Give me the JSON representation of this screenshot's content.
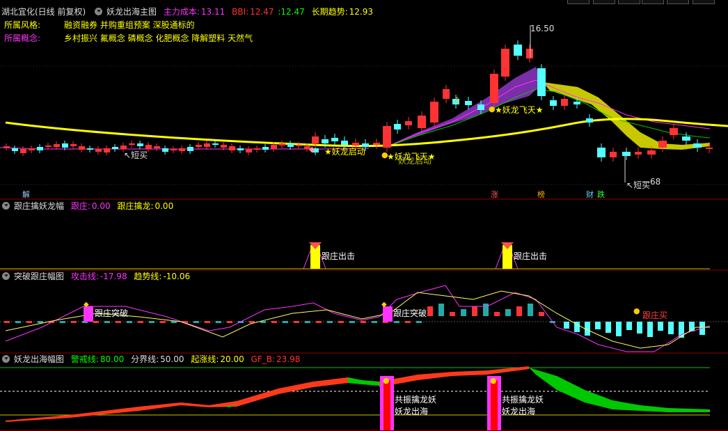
{
  "stock": {
    "title": "湖北宜化(日线 前复权)",
    "indicator": "妖龙出海主图",
    "main_cost_label": "主力成本:",
    "main_cost": "13.11",
    "bbi_label": "BBI:",
    "bbi": "12.47",
    "bbi2": ":12.47",
    "trend_label": "长期趋势:",
    "trend": "12.93"
  },
  "style": {
    "label": "所属风格:",
    "value": "融资融券 并购重组预案 深股通标的"
  },
  "concept": {
    "label": "所属概念:",
    "value": "乡村振兴 氟概念 磷概念 化肥概念 降解塑料 天然气"
  },
  "price_high": "16.50",
  "price_low": "—68",
  "main_labels": {
    "short_buy_left": "短买",
    "short_buy_right": "短买",
    "launch1": "妖龙启动",
    "launch2": "妖龙启动",
    "launch2b": "妖龙飞天",
    "fly": "妖龙飞天"
  },
  "bottom_tags": {
    "jie": "解",
    "zhang": "涨",
    "bang": "榜",
    "cai": "财",
    "die": "跌"
  },
  "panel2": {
    "name": "跟庄擒妖龙幅",
    "a_label": "跟庄:",
    "a_val": "0.00",
    "b_label": "跟庄擒龙:",
    "b_val": "0.00",
    "sig": "跟庄出击"
  },
  "panel3": {
    "name": "突破跟庄幅图",
    "a_label": "攻击线:",
    "a_val": "-17.98",
    "b_label": "趋势线:",
    "b_val": "-10.06",
    "sig1": "跟庄突破",
    "sig2": "跟庄突破",
    "sig3": "跟庄买"
  },
  "panel4": {
    "name": "妖龙出海幅图",
    "a_label": "警戒线:",
    "a_val": "80.00",
    "b_label": "分界线:",
    "b_val": "50.00",
    "c_label": "起涨线:",
    "c_val": "20.00",
    "d_label": "GF_B:",
    "d_val": "23.98",
    "sig_a": "共振擒龙妖",
    "sig_b": "妖龙出海"
  },
  "colors": {
    "up": "#ff3333",
    "down": "#54ffff",
    "yellow": "#ffff00",
    "magenta": "#ff33ff",
    "purple": "#7a2ea8",
    "green": "#00c800",
    "olive": "#c8c800"
  }
}
